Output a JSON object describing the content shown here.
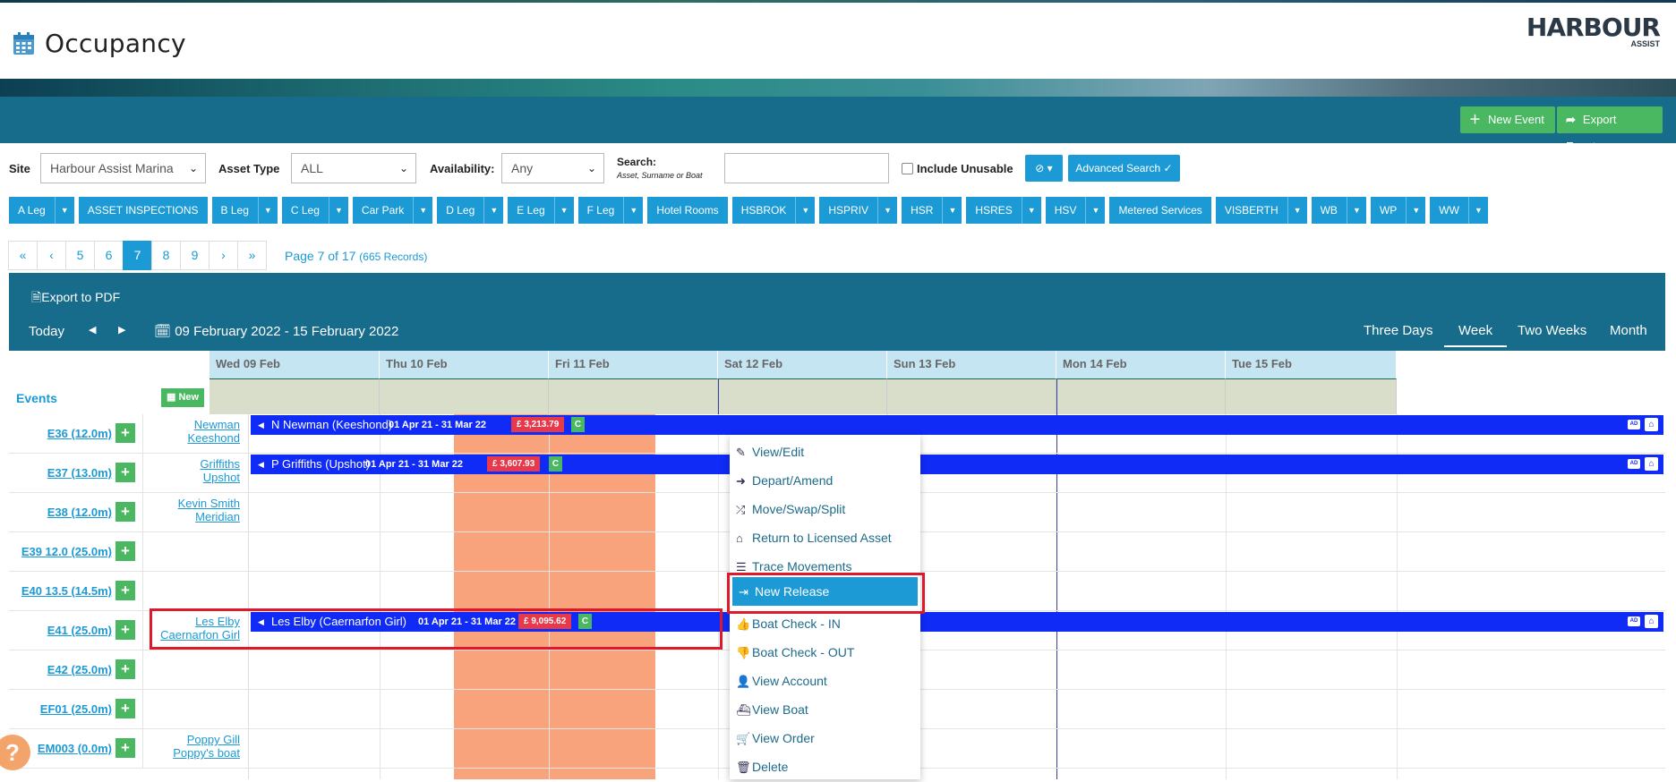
{
  "header": {
    "title": "Occupancy",
    "logo_name": "HARBOUR",
    "logo_sub": "ASSIST"
  },
  "actions": {
    "new_event": "New Event",
    "export_events": "Export Events"
  },
  "filters": {
    "site_label": "Site",
    "site_value": "Harbour Assist Marina",
    "asset_type_label": "Asset Type",
    "asset_type_value": "ALL",
    "availability_label": "Availability:",
    "availability_value": "Any",
    "search_label": "Search:",
    "search_hint": "Asset, Surname or Boat",
    "search_value": "",
    "include_unusable_label": "Include Unusable",
    "include_unusable_checked": false,
    "advanced_search": "Advanced Search"
  },
  "asset_groups": [
    {
      "label": "A Leg",
      "dropdown": true
    },
    {
      "label": "ASSET INSPECTIONS",
      "dropdown": false
    },
    {
      "label": "B Leg",
      "dropdown": true
    },
    {
      "label": "C Leg",
      "dropdown": true
    },
    {
      "label": "Car Park",
      "dropdown": true
    },
    {
      "label": "D Leg",
      "dropdown": true
    },
    {
      "label": "E Leg",
      "dropdown": true
    },
    {
      "label": "F Leg",
      "dropdown": true
    },
    {
      "label": "Hotel Rooms",
      "dropdown": false
    },
    {
      "label": "HSBROK",
      "dropdown": true
    },
    {
      "label": "HSPRIV",
      "dropdown": true
    },
    {
      "label": "HSR",
      "dropdown": true
    },
    {
      "label": "HSRES",
      "dropdown": true
    },
    {
      "label": "HSV",
      "dropdown": true
    },
    {
      "label": "Metered Services",
      "dropdown": false
    },
    {
      "label": "VISBERTH",
      "dropdown": true
    },
    {
      "label": "WB",
      "dropdown": true
    },
    {
      "label": "WP",
      "dropdown": true
    },
    {
      "label": "WW",
      "dropdown": true
    }
  ],
  "pagination": {
    "first": "«",
    "prev": "‹",
    "pages": [
      "5",
      "6",
      "7",
      "8",
      "9"
    ],
    "current": "7",
    "next": "›",
    "last": "»",
    "info": "Page 7 of 17",
    "records": "(665 Records)"
  },
  "scheduler": {
    "export_pdf": "Export to PDF",
    "today": "Today",
    "prev": "◀",
    "next": "▶",
    "date_range": "09 February 2022 - 15 February 2022",
    "views": [
      "Three Days",
      "Week",
      "Two Weeks",
      "Month"
    ],
    "selected_view": "Week",
    "days": [
      "Wed 09 Feb",
      "Thu 10 Feb",
      "Fri 11 Feb",
      "Sat 12 Feb",
      "Sun 13 Feb",
      "Mon 14 Feb",
      "Tue 15 Feb"
    ],
    "events_label": "Events",
    "new_label": "New"
  },
  "rows": [
    {
      "asset": "E36 (12.0m)",
      "customer": [
        "Newman",
        "Keeshond"
      ]
    },
    {
      "asset": "E37 (13.0m)",
      "customer": [
        "Griffiths",
        "Upshot"
      ]
    },
    {
      "asset": "E38 (12.0m)",
      "customer": [
        "Kevin Smith",
        "Meridian"
      ]
    },
    {
      "asset": "E39 12.0 (25.0m)",
      "customer": [
        "",
        ""
      ]
    },
    {
      "asset": "E40 13.5 (14.5m)",
      "customer": [
        "",
        ""
      ]
    },
    {
      "asset": "E41 (25.0m)",
      "customer": [
        "Les Elby",
        "Caernarfon Girl"
      ]
    },
    {
      "asset": "E42 (25.0m)",
      "customer": [
        "",
        ""
      ]
    },
    {
      "asset": "EF01 (25.0m)",
      "customer": [
        "",
        ""
      ]
    },
    {
      "asset": "EM003 (0.0m)",
      "customer": [
        "Poppy Gill",
        "Poppy's boat"
      ]
    }
  ],
  "bookings": [
    {
      "name": "N Newman (Keeshond)",
      "dates": "01 Apr 21 - 31 Mar 22",
      "amount": "£ 3,213.79",
      "status": "C",
      "tag": "AD"
    },
    {
      "name": "P Griffiths (Upshot)",
      "dates": "01 Apr 21 - 31 Mar 22",
      "amount": "£ 3,607.93",
      "status": "C",
      "tag": "AD"
    },
    {
      "name": "Les Elby (Caernarfon Girl)",
      "dates": "01 Apr 21 - 31 Mar 22",
      "amount": "£ 9,095.62",
      "status": "C",
      "tag": "AD"
    }
  ],
  "context_menu": [
    {
      "label": "View/Edit",
      "icon": "edit-icon",
      "glyph": "✎"
    },
    {
      "label": "Depart/Amend",
      "icon": "depart-icon",
      "glyph": "➜"
    },
    {
      "label": "Move/Swap/Split",
      "icon": "shuffle-icon",
      "glyph": "⤮"
    },
    {
      "label": "Return to Licensed Asset",
      "icon": "home-icon",
      "glyph": "⌂"
    },
    {
      "label": "Trace Movements",
      "icon": "list-icon",
      "glyph": "☰"
    },
    {
      "label": "New Release",
      "icon": "release-icon",
      "glyph": "⇥"
    },
    {
      "label": "Boat Check - IN",
      "icon": "thumbs-up-icon",
      "glyph": "👍"
    },
    {
      "label": "Boat Check - OUT",
      "icon": "thumbs-down-icon",
      "glyph": "👎"
    },
    {
      "label": "View Account",
      "icon": "user-icon",
      "glyph": "👤"
    },
    {
      "label": "View Boat",
      "icon": "boat-icon",
      "glyph": "⛴"
    },
    {
      "label": "View Order",
      "icon": "cart-icon",
      "glyph": "🛒"
    },
    {
      "label": "Delete",
      "icon": "trash-icon",
      "glyph": "🗑"
    }
  ],
  "context_selected": "New Release",
  "colors": {
    "primary": "#1b9ad6",
    "teal": "#176b8b",
    "green": "#49b861",
    "booking": "#0f2bf5",
    "highlight": "#e0182b",
    "unavailable": "#f8a37c"
  }
}
